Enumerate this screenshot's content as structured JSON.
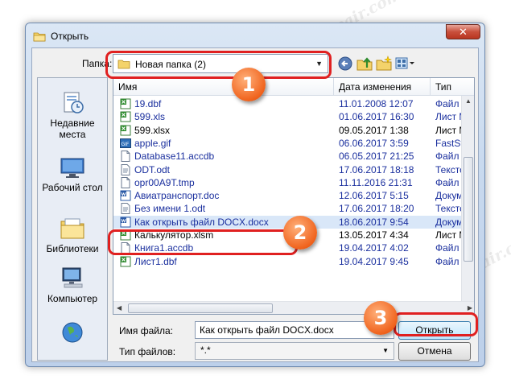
{
  "dialog": {
    "title": "Открыть",
    "close_glyph": "✕"
  },
  "toolbar": {
    "look_in_label": "Папка:",
    "look_in_value": "Новая папка (2)",
    "back_icon": "back-arrow-icon",
    "up_icon": "up-folder-icon",
    "new_folder_icon": "new-folder-icon",
    "views_icon": "views-menu-icon"
  },
  "places": [
    {
      "label": "Недавние места",
      "icon": "recent-places-icon"
    },
    {
      "label": "Рабочий стол",
      "icon": "desktop-icon"
    },
    {
      "label": "Библиотеки",
      "icon": "libraries-icon"
    },
    {
      "label": "Компьютер",
      "icon": "computer-icon"
    },
    {
      "label": "",
      "icon": "network-icon"
    }
  ],
  "columns": {
    "name": "Имя",
    "date": "Дата изменения",
    "type": "Тип"
  },
  "files": [
    {
      "name": "19.dbf",
      "date": "11.01.2008 12:07",
      "type": "Файл \"",
      "icon": "excel-icon",
      "blue": true
    },
    {
      "name": "599.xls",
      "date": "01.06.2017 16:30",
      "type": "Лист M",
      "icon": "excel-icon",
      "blue": true
    },
    {
      "name": "599.xlsx",
      "date": "09.05.2017 1:38",
      "type": "Лист M",
      "icon": "excel-icon",
      "blue": false
    },
    {
      "name": "apple.gif",
      "date": "06.06.2017 3:59",
      "type": "FastSto",
      "icon": "image-icon",
      "blue": true
    },
    {
      "name": "Database11.accdb",
      "date": "06.05.2017 21:25",
      "type": "Файл \"",
      "icon": "blank-file-icon",
      "blue": true
    },
    {
      "name": "ODT.odt",
      "date": "17.06.2017 18:18",
      "type": "Текстс",
      "icon": "text-file-icon",
      "blue": true
    },
    {
      "name": "opr00A9T.tmp",
      "date": "11.11.2016 21:31",
      "type": "Файл \"",
      "icon": "blank-file-icon",
      "blue": true
    },
    {
      "name": "Авиатранспорт.doc",
      "date": "12.06.2017 5:15",
      "type": "Докум",
      "icon": "word-icon",
      "blue": true
    },
    {
      "name": "Без имени 1.odt",
      "date": "17.06.2017 18:20",
      "type": "Текстс",
      "icon": "text-file-icon",
      "blue": true
    },
    {
      "name": "Как открыть файл DOCX.docx",
      "date": "18.06.2017 9:54",
      "type": "Докум",
      "icon": "word-icon",
      "blue": true
    },
    {
      "name": "Калькулятор.xlsm",
      "date": "13.05.2017 4:34",
      "type": "Лист M",
      "icon": "excel-icon",
      "blue": false
    },
    {
      "name": "Книга1.accdb",
      "date": "19.04.2017 4:02",
      "type": "Файл \"",
      "icon": "blank-file-icon",
      "blue": true
    },
    {
      "name": "Лист1.dbf",
      "date": "19.04.2017 9:45",
      "type": "Файл \"",
      "icon": "excel-icon",
      "blue": true
    }
  ],
  "selected_index": 9,
  "footer": {
    "filename_label": "Имя файла:",
    "filename_value": "Как открыть файл DOCX.docx",
    "filetype_label": "Тип файлов:",
    "filetype_value": "*.*",
    "open_label": "Открыть",
    "cancel_label": "Отмена"
  },
  "annotations": {
    "badge1": "1",
    "badge2": "2",
    "badge3": "3",
    "color": "#e02020"
  },
  "watermark": "Soringpcrepair.com"
}
